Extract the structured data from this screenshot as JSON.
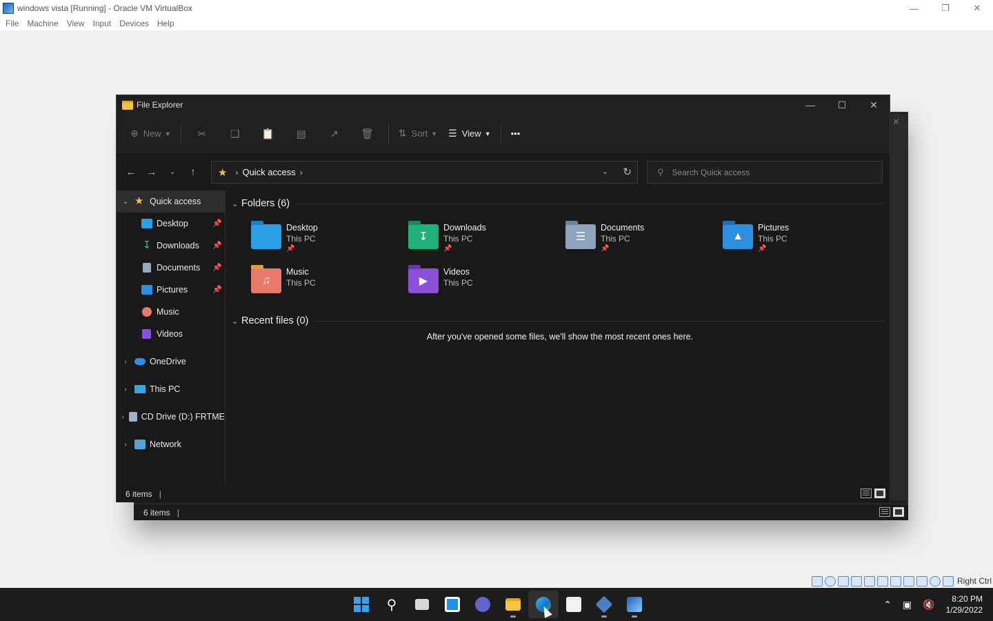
{
  "vbox": {
    "title": "windows vista [Running] - Oracle VM VirtualBox",
    "menu": [
      "File",
      "Machine",
      "View",
      "Input",
      "Devices",
      "Help"
    ],
    "host_key": "Right Ctrl"
  },
  "explorer": {
    "title": "File Explorer",
    "toolbar": {
      "new_label": "New",
      "sort_label": "Sort",
      "view_label": "View",
      "more_label": "•••"
    },
    "address": {
      "breadcrumb": "Quick access",
      "search_placeholder": "Search Quick access"
    },
    "nav": {
      "quick_access": "Quick access",
      "pinned": [
        {
          "label": "Desktop",
          "icon": "desktop-icon",
          "pinned": true
        },
        {
          "label": "Downloads",
          "icon": "downloads-icon",
          "pinned": true
        },
        {
          "label": "Documents",
          "icon": "documents-icon",
          "pinned": true
        },
        {
          "label": "Pictures",
          "icon": "pictures-icon",
          "pinned": true
        },
        {
          "label": "Music",
          "icon": "music-icon",
          "pinned": false
        },
        {
          "label": "Videos",
          "icon": "videos-icon",
          "pinned": false
        }
      ],
      "roots": [
        {
          "label": "OneDrive",
          "icon": "onedrive-icon"
        },
        {
          "label": "This PC",
          "icon": "this-pc-icon"
        },
        {
          "label": "CD Drive (D:) FRTME",
          "icon": "cd-drive-icon"
        },
        {
          "label": "Network",
          "icon": "network-icon"
        }
      ]
    },
    "folders_header": "Folders (6)",
    "folders": [
      {
        "name": "Desktop",
        "location": "This PC",
        "pinned": true,
        "color": "#2b9ee8"
      },
      {
        "name": "Downloads",
        "location": "This PC",
        "pinned": true,
        "color": "#20b07c"
      },
      {
        "name": "Documents",
        "location": "This PC",
        "pinned": true,
        "color": "#8ea3bd"
      },
      {
        "name": "Pictures",
        "location": "This PC",
        "pinned": true,
        "color": "#2e8fe0"
      },
      {
        "name": "Music",
        "location": "This PC",
        "pinned": false,
        "color": "#e8786a"
      },
      {
        "name": "Videos",
        "location": "This PC",
        "pinned": false,
        "color": "#8a50d8"
      }
    ],
    "recent_header": "Recent files (0)",
    "recent_empty": "After you've opened some files, we'll show the most recent ones here.",
    "status": "6 items"
  },
  "ghost_window": {
    "status": "6 items"
  },
  "taskbar": {
    "time": "8:20 PM",
    "date": "1/29/2022",
    "apps": [
      "start-button",
      "search",
      "task-view",
      "widgets",
      "chat",
      "file-explorer",
      "edge",
      "store",
      "virtualbox",
      "vista-vm"
    ]
  }
}
